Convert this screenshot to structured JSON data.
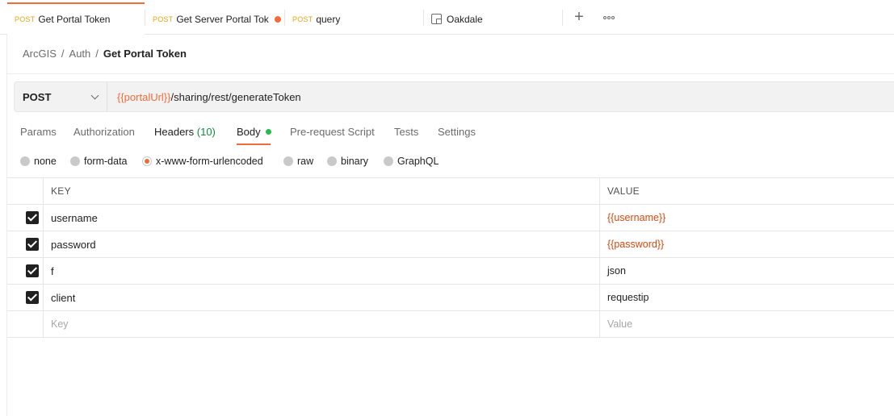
{
  "tabs": [
    {
      "method": "POST",
      "title": "Get Portal Token"
    },
    {
      "method": "POST",
      "title": "Get Server Portal Tok"
    },
    {
      "method": "POST",
      "title": "query"
    },
    {
      "title": "Oakdale"
    }
  ],
  "breadcrumb": {
    "items": [
      "ArcGIS",
      "Auth"
    ],
    "separator": "/",
    "current": "Get Portal Token"
  },
  "request": {
    "method": "POST",
    "url_var": "{{portalUrl}}",
    "url_path": "/sharing/rest/generateToken"
  },
  "request_tabs": {
    "params": "Params",
    "authorization": "Authorization",
    "headers": "Headers",
    "headers_count": "(10)",
    "body": "Body",
    "prerequest": "Pre-request Script",
    "tests": "Tests",
    "settings": "Settings"
  },
  "body_types": {
    "none": "none",
    "form_data": "form-data",
    "urlencoded": "x-www-form-urlencoded",
    "raw": "raw",
    "binary": "binary",
    "graphql": "GraphQL",
    "selected": "x-www-form-urlencoded"
  },
  "table": {
    "key_header": "KEY",
    "value_header": "VALUE",
    "rows": [
      {
        "key": "username",
        "value": "{{username}}",
        "checked": true
      },
      {
        "key": "password",
        "value": "{{password}}",
        "checked": true
      },
      {
        "key": "f",
        "value": "json",
        "checked": true
      },
      {
        "key": "client",
        "value": "requestip",
        "checked": true
      }
    ],
    "key_placeholder": "Key",
    "value_placeholder": "Value"
  },
  "colors": {
    "accent": "#f26b3a",
    "method_label": "#e8a316",
    "variable": "#d9480f",
    "headers_count": "#0f8a3e",
    "body_dot": "#26b94e"
  },
  "icons": {
    "environment": "environment-icon",
    "new_tab": "plus-icon",
    "more": "more-options-icon",
    "method_dropdown": "chevron-down-icon"
  }
}
